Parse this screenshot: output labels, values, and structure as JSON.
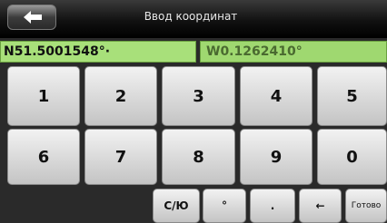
{
  "header": {
    "title": "Ввод координат",
    "back_icon": "arrow-left-icon"
  },
  "coordinates": {
    "latitude": "N51.5001548°·",
    "longitude": "W0.1262410°"
  },
  "keypad": {
    "row1": [
      "1",
      "2",
      "3",
      "4",
      "5"
    ],
    "row2": [
      "6",
      "7",
      "8",
      "9",
      "0"
    ],
    "hemisphere_label": "С/Ю",
    "degree_label": "°",
    "dot_label": ".",
    "backspace_label": "←",
    "done_label": "Готово"
  }
}
